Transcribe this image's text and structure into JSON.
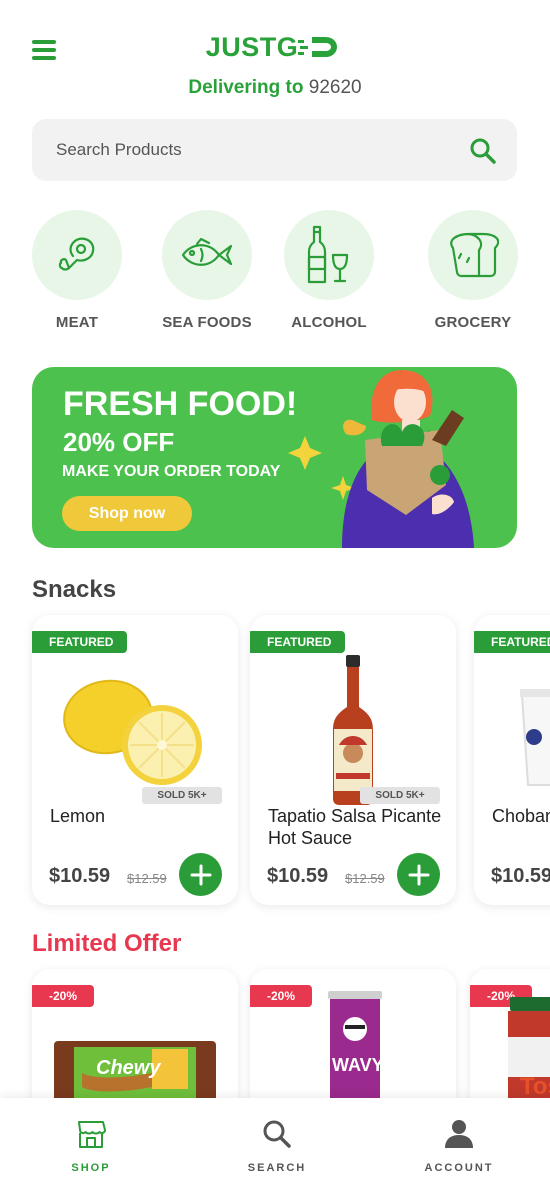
{
  "header": {
    "logo_text": "JUSTG",
    "delivering_label": "Delivering to",
    "zip": "92620"
  },
  "search": {
    "placeholder": "Search Products"
  },
  "categories": [
    {
      "label": "MEAT",
      "icon": "meat-icon"
    },
    {
      "label": "SEA FOODS",
      "icon": "fish-icon"
    },
    {
      "label": "ALCOHOL",
      "icon": "bottle-icon"
    },
    {
      "label": "GROCERY",
      "icon": "bread-icon"
    }
  ],
  "banner": {
    "title": "FRESH FOOD!",
    "discount": "20% OFF",
    "subtitle": "MAKE YOUR ORDER TODAY",
    "cta": "Shop now"
  },
  "snacks": {
    "title": "Snacks",
    "items": [
      {
        "badge": "FEATURED",
        "name": "Lemon",
        "sold": "SOLD 5K+",
        "price": "$10.59",
        "old_price": "$12.59"
      },
      {
        "badge": "FEATURED",
        "name": "Tapatio Salsa Picante Hot Sauce",
        "sold": "SOLD 5K+",
        "price": "$10.59",
        "old_price": "$12.59"
      },
      {
        "badge": "FEATURED",
        "name": "Chobani Yogurt",
        "price": "$10.59"
      }
    ]
  },
  "limited": {
    "title": "Limited Offer",
    "items": [
      {
        "badge": "-20%",
        "image": "Chewy"
      },
      {
        "badge": "-20%",
        "image": "WAVY"
      },
      {
        "badge": "-20%",
        "image": "Tos"
      }
    ]
  },
  "tabbar": {
    "shop": "SHOP",
    "search": "SEARCH",
    "account": "ACCOUNT"
  },
  "colors": {
    "brand_green": "#2aa23a",
    "banner_green": "#4cc14d",
    "offer_red": "#e8384f",
    "cta_yellow": "#f0c93a"
  }
}
